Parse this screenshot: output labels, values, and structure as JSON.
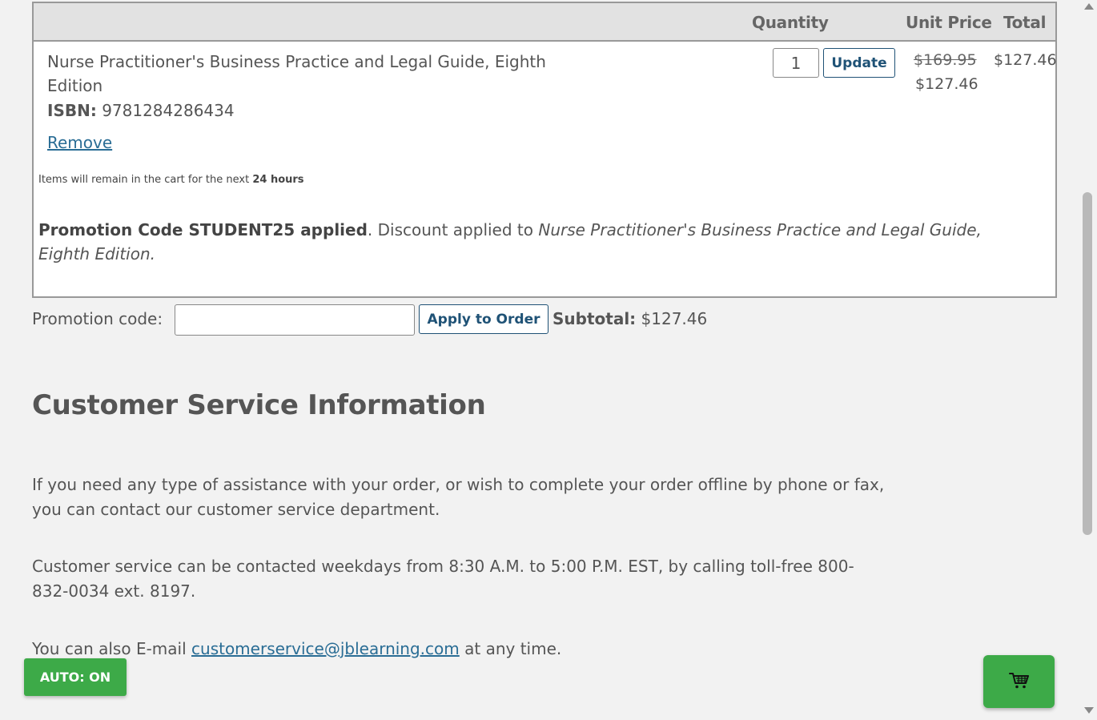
{
  "cart": {
    "headers": {
      "quantity": "Quantity",
      "unit_price": "Unit Price",
      "total": "Total"
    },
    "item": {
      "title": "Nurse Practitioner's Business Practice and Legal Guide, Eighth Edition",
      "isbn_label": "ISBN:",
      "isbn": "9781284286434",
      "remove_label": "Remove",
      "quantity": "1",
      "update_label": "Update",
      "original_price": "$169.95",
      "discounted_price": "$127.46",
      "line_total": "$127.46"
    },
    "note_prefix": "Items will remain in the cart for the next",
    "note_duration": "24 hours",
    "promo_applied_bold": "Promotion Code STUDENT25 applied",
    "promo_applied_text": ". Discount applied to",
    "promo_applied_title": "Nurse Practitioner's Business Practice and Legal Guide, Eighth Edition."
  },
  "promo": {
    "label": "Promotion code:",
    "value": "",
    "apply_label": "Apply to Order",
    "subtotal_label": "Subtotal:",
    "subtotal_value": "$127.46"
  },
  "customer_service": {
    "heading": "Customer Service Information",
    "para1": "If you need any type of assistance with your order, or wish to complete your order offline by phone or fax, you can contact our customer service department.",
    "para2": "Customer service can be contacted weekdays from 8:30 A.M. to 5:00 P.M. EST, by calling toll-free 800-832-0034 ext. 8197.",
    "para3_prefix": "You can also E-mail",
    "email": "customerservice@jblearning.com",
    "para3_suffix": "at any time."
  },
  "floating": {
    "auto_label": "AUTO: ON",
    "cart_icon": "shopping-cart-icon"
  },
  "colors": {
    "accent_green": "#3daa48",
    "link_blue": "#2a6d95",
    "button_navy": "#1f5276"
  }
}
